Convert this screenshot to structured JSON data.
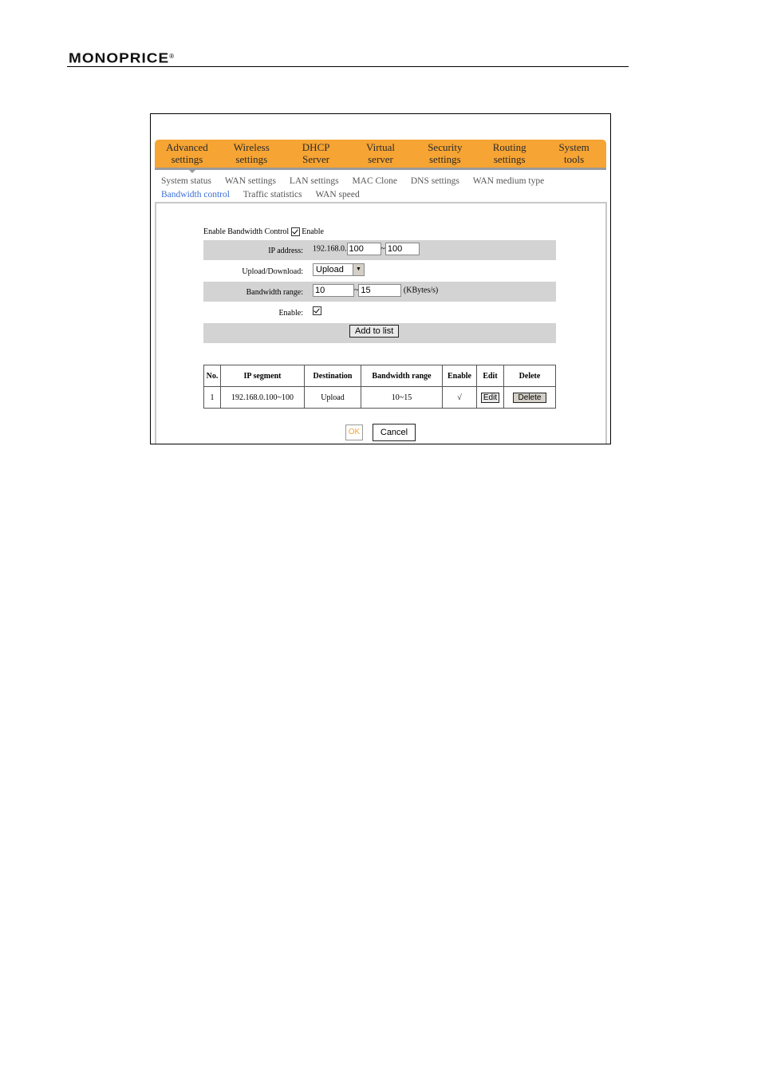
{
  "header": {
    "brand": "MONOPRICE",
    "registered": "®"
  },
  "topnav": [
    {
      "line1": "Advanced",
      "line2": "settings"
    },
    {
      "line1": "Wireless",
      "line2": "settings"
    },
    {
      "line1": "DHCP",
      "line2": "Server"
    },
    {
      "line1": "Virtual",
      "line2": "server"
    },
    {
      "line1": "Security",
      "line2": "settings"
    },
    {
      "line1": "Routing",
      "line2": "settings"
    },
    {
      "line1": "System",
      "line2": "tools"
    }
  ],
  "subnav": [
    {
      "label": "System status"
    },
    {
      "label": "WAN settings"
    },
    {
      "label": "LAN settings"
    },
    {
      "label": "MAC Clone"
    },
    {
      "label": "DNS settings"
    },
    {
      "label": "WAN medium type"
    },
    {
      "label": "Bandwidth control",
      "active": true
    },
    {
      "label": "Traffic statistics"
    },
    {
      "label": "WAN speed"
    }
  ],
  "form": {
    "enable_control_label": "Enable Bandwidth Control",
    "enable_control_text": "Enable",
    "ip_label": "IP address:",
    "ip_prefix": "192.168.0.",
    "ip_start": "100",
    "ip_sep": "~",
    "ip_end": "100",
    "updown_label": "Upload/Download:",
    "updown_value": "Upload",
    "range_label": "Bandwidth range:",
    "range_min": "10",
    "range_sep": "~",
    "range_max": "15",
    "range_unit": "(KBytes/s)",
    "enable_label": "Enable:",
    "add_button": "Add to list"
  },
  "table": {
    "headers": [
      "No.",
      "IP segment",
      "Destination",
      "Bandwidth range",
      "Enable",
      "Edit",
      "Delete"
    ],
    "rows": [
      {
        "no": "1",
        "ip": "192.168.0.100~100",
        "dest": "Upload",
        "range": "10~15",
        "enable": "√",
        "edit": "Edit",
        "delete": "Delete"
      }
    ]
  },
  "buttons": {
    "ok": "OK",
    "cancel": "Cancel"
  },
  "colors": {
    "nav_bg": "#f6a433",
    "active_sub": "#3c6fd8",
    "row_gray": "#d3d3d3"
  }
}
